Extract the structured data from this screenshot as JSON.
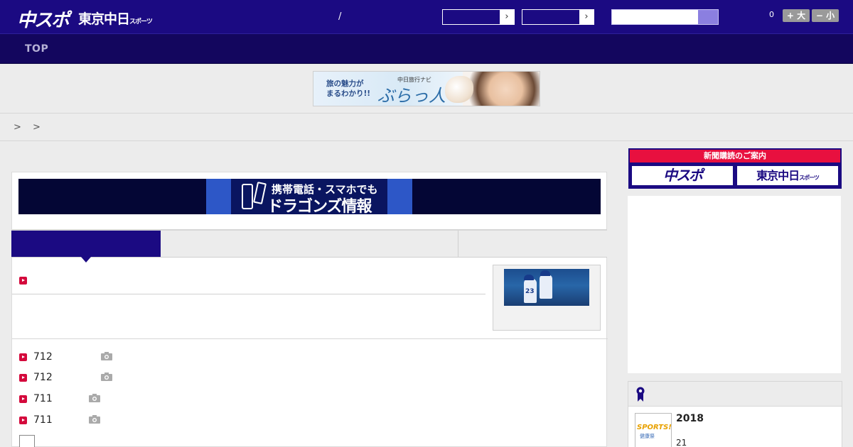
{
  "header": {
    "logo_chuspo": "中スポ",
    "logo_tokyo": "東京中日",
    "logo_tokyo_small": "スポーツ",
    "separator": "/",
    "count": "0",
    "font_bigger": "+ 大",
    "font_smaller": "− 小",
    "colors": {
      "bg": "#1b0a82",
      "search_button": "#8b7fe0"
    }
  },
  "nav": {
    "items": [
      {
        "label": "TOP"
      }
    ]
  },
  "banner_ad": {
    "text_line1": "旅の魅力が",
    "text_line2": "まるわかり!!",
    "brand_small": "中日旅行ナビ",
    "brand": "ぶらっ人"
  },
  "breadcrumb": {
    "separators": ">   >"
  },
  "main": {
    "promo": {
      "line1": "携帯電話・スマホでも",
      "line2": "ドラゴンズ情報"
    },
    "tabs": [
      {
        "label": ""
      },
      {
        "label": ""
      },
      {
        "label": ""
      },
      {
        "label": ""
      }
    ],
    "thumb_number": "23",
    "news": [
      {
        "date": "712",
        "icon": "camera-icon"
      },
      {
        "date": "712",
        "icon": "camera-icon"
      },
      {
        "date": "711",
        "icon": "camera-icon"
      },
      {
        "date": "711",
        "icon": "camera-icon"
      }
    ]
  },
  "sidebar": {
    "subscription": {
      "heading": "新聞購読のご案内",
      "btn1": "中スポ",
      "btn2": "東京中日",
      "btn2_small": "スポーツ"
    },
    "ranking": {
      "thumb_text": "SPORTS!!",
      "thumb_sub": "健康祭",
      "year": "2018",
      "sub": "21"
    },
    "colors": {
      "accent_red": "#e8103f"
    }
  }
}
